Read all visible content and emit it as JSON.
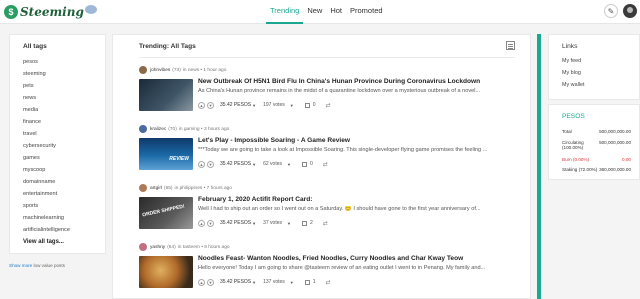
{
  "header": {
    "logo_text": "Steeming",
    "logo_mark": "$",
    "nav": [
      "Trending",
      "New",
      "Hot",
      "Promoted"
    ],
    "active_nav": "Trending",
    "pencil_icon": "pencil-icon"
  },
  "sidebar": {
    "title": "All tags",
    "tags": [
      "pesos",
      "steeming",
      "pets",
      "news",
      "media",
      "finance",
      "travel",
      "cybersecurity",
      "games",
      "myscoop",
      "domainname",
      "entertainment",
      "sports",
      "machinelearning",
      "artificialintelligence"
    ],
    "all_tags_link": "View all tags...",
    "low_value_link": "Show more",
    "low_value_text": " low value posts"
  },
  "feed": {
    "title": "Trending: All Tags",
    "posts": [
      {
        "author": "johnvibes",
        "rep": "(73)",
        "context": "in news • 1 hour ago",
        "title": "New Outbreak Of H5N1 Bird Flu In China's Hunan Province During Coronavirus Lockdown",
        "body": "As China's Hunan province remains in the midst of a quarantine lockdown over a mysterious outbreak of a novel...",
        "payout": "35.42 PESOS",
        "votes": "197 votes",
        "comments": "0",
        "thumb_text": ""
      },
      {
        "author": "kralizec",
        "rep": "(70)",
        "context": "in gaming • 3 hours ago",
        "title": "Let's Play - Impossible Soaring - A Game Review",
        "body": "***Today we are going to take a look at Impossible Soaring. This single-developer flying game promises the feeling ...",
        "payout": "35.42 PESOS",
        "votes": "62 votes",
        "comments": "0",
        "thumb_text": "REVIEW"
      },
      {
        "author": "artgirl",
        "rep": "(65)",
        "context": "in philippines • 7 hours ago",
        "title": "February 1, 2020 Actifit Report Card:",
        "body": "Well I had to ship out an order so I went out on a Saturday. 😊 I should have gone to the first year anniversary of...",
        "payout": "35.42 PESOS",
        "votes": "37 votes",
        "comments": "2",
        "thumb_text": "ORDER SHIPPED!"
      },
      {
        "author": "yashny",
        "rep": "(64)",
        "context": "in tasteem • 8 hours ago",
        "title": "Noodles Feast- Wanton Noodles, Fried Noodles, Curry Noodles and Char Kway Teow",
        "body": "Hello everyone! Today I am going to share @tasteem review of an eating outlet I went to in Penang. My family and...",
        "payout": "35.42 PESOS",
        "votes": "137 votes",
        "comments": "1",
        "thumb_text": ""
      }
    ]
  },
  "links": {
    "title": "Links",
    "items": [
      "My feed",
      "My blog",
      "My wallet"
    ]
  },
  "pesos": {
    "title": "PESOS",
    "rows": [
      {
        "label": "Total",
        "value": "500,000,000.00"
      },
      {
        "label": "Circulating (100.00%)",
        "value": "500,000,000.00"
      },
      {
        "label": "Burn (0.00%)",
        "value": "0.00"
      },
      {
        "label": "Staking (72.00%)",
        "value": "360,000,000.00"
      }
    ]
  },
  "colors": {
    "accent": "#1aa891",
    "burn": "#d9383a",
    "logo": "#2a9d64"
  }
}
